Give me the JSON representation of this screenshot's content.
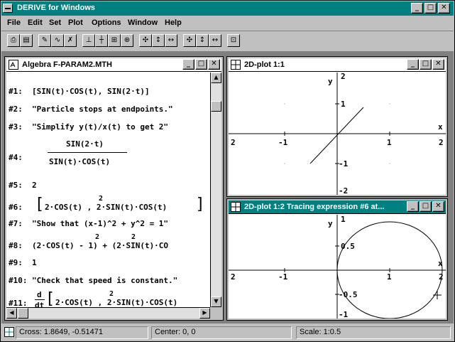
{
  "app": {
    "title": "DERIVE for Windows"
  },
  "window_controls": {
    "minimize": "_",
    "maximize": "□",
    "close": "✕"
  },
  "menu": [
    "File",
    "Edit",
    "Set",
    "Plot",
    "Options",
    "Window",
    "Help"
  ],
  "toolbar_icons": [
    "print-icon",
    "print-preview-icon",
    "author-icon",
    "simplify-icon",
    "approximate-icon",
    "plot-icon",
    "solve-icon",
    "zoom-in-icon",
    "zoom-out-icon",
    "zoom-box-icon",
    "pan-icon",
    "scale-x-icon",
    "scale-y-icon",
    "center-icon",
    "trace-icon",
    "scale-up-icon",
    "scale-down-icon",
    "overlay-icon"
  ],
  "algebra": {
    "title": "Algebra  F-PARAM2.MTH",
    "expressions": [
      {
        "num": "#1:",
        "text": "[SIN(t)·COS(t), SIN(2·t)]"
      },
      {
        "num": "#2:",
        "text": "\"Particle stops at endpoints.\""
      },
      {
        "num": "#3:",
        "text": "\"Simplify y(t)/x(t) to get 2\""
      },
      {
        "num": "#4:",
        "numer": "SIN(2·t)",
        "denom": "SIN(t)·COS(t)"
      },
      {
        "num": "#5:",
        "text": "2"
      },
      {
        "num": "#6:",
        "text": "2·COS(t) , 2·SIN(t)·COS(t)",
        "sup": "2"
      },
      {
        "num": "#7:",
        "text": "\"Show that (x-1)^2 + y^2 = 1\""
      },
      {
        "num": "#8:",
        "text": "(2·COS(t)  - 1)  + (2·SIN(t)·CO",
        "sup1": "2",
        "sup2": "2"
      },
      {
        "num": "#9:",
        "text": "1"
      },
      {
        "num": "#10:",
        "text": "\"Check that speed is constant.\""
      },
      {
        "num": "#11:",
        "text": "2·COS(t) , 2·SIN(t)·COS(t)",
        "deriv_top": "d",
        "deriv_bot": "dt",
        "sup": "2"
      }
    ]
  },
  "plot1": {
    "title": "2D-plot 1:1",
    "x_ticks": [
      "2",
      "-1",
      "1",
      "2"
    ],
    "y_ticks": [
      "2",
      "1",
      "-1",
      "-2"
    ],
    "x_label": "x",
    "y_label": "y"
  },
  "plot2": {
    "title": "2D-plot 1:2  Tracing expression #6 at...",
    "x_ticks": [
      "2",
      "-1",
      "1",
      "2"
    ],
    "y_ticks": [
      "1",
      "0.5",
      "-0.5",
      "-1"
    ],
    "x_label": "x",
    "y_label": "y"
  },
  "status": {
    "cross": "Cross: 1.8649, -0.51471",
    "center": "Center: 0, 0",
    "scale": "Scale: 1:0.5"
  },
  "colors": {
    "title_active": "#008080",
    "face": "#c0c0c0",
    "mdi_bg": "#808080"
  }
}
